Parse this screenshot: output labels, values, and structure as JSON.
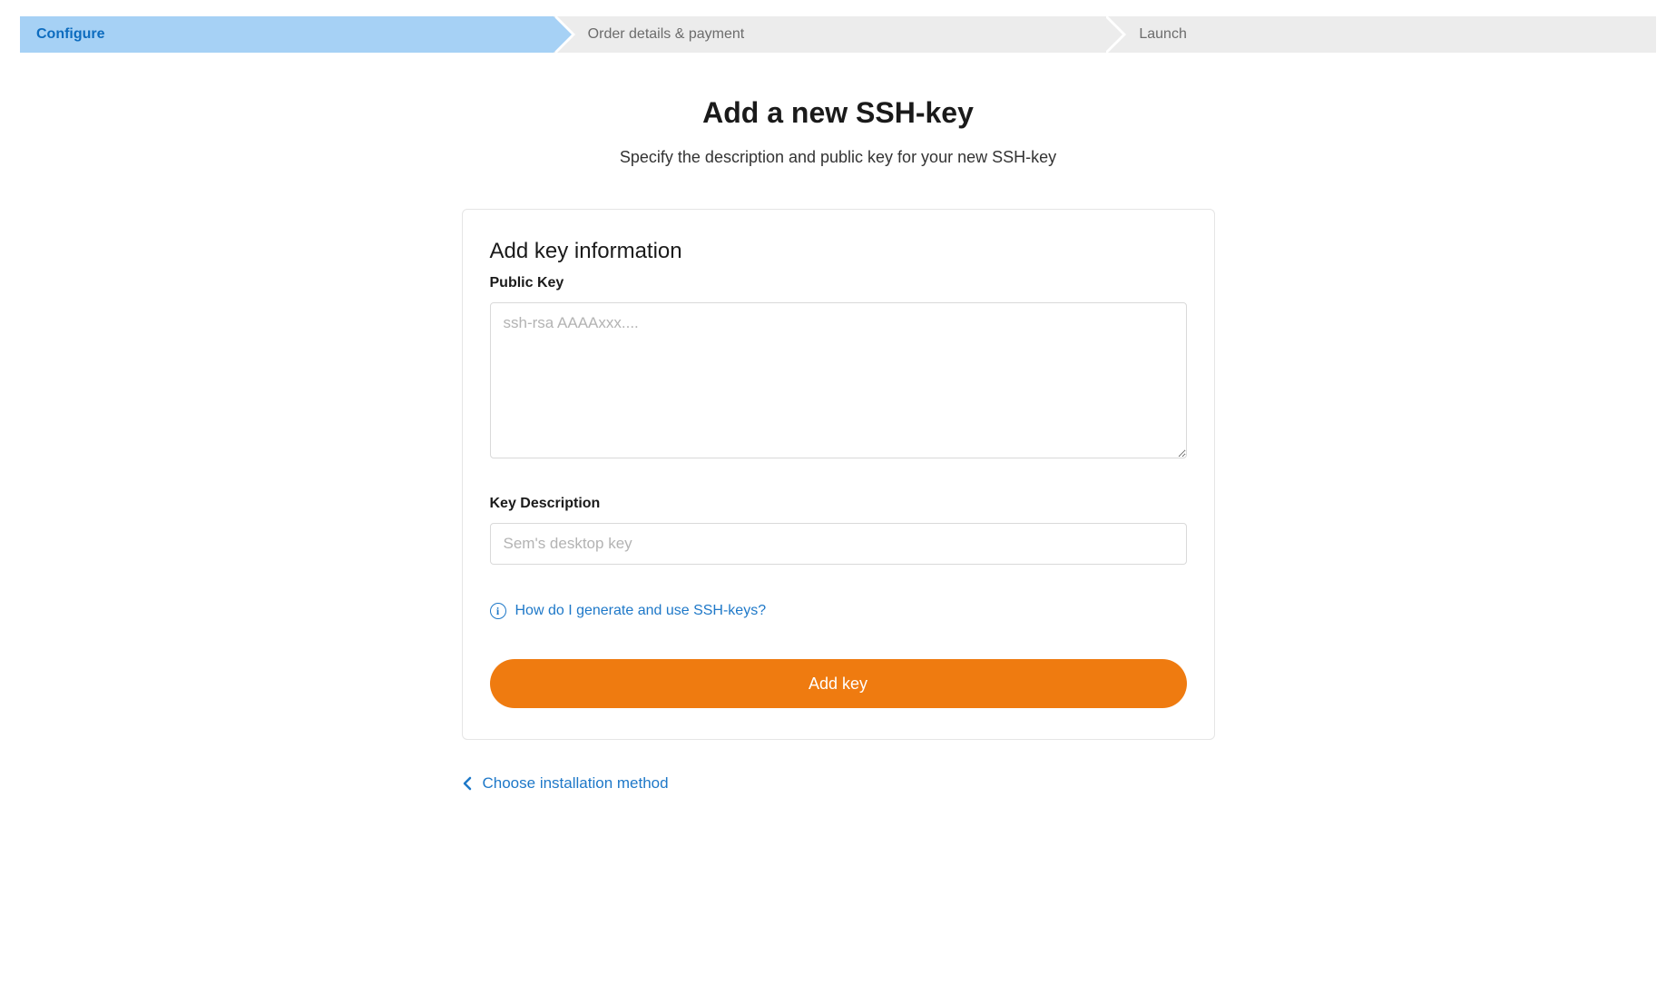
{
  "progress": {
    "steps": [
      {
        "label": "Configure",
        "active": true
      },
      {
        "label": "Order details & payment",
        "active": false
      },
      {
        "label": "Launch",
        "active": false
      }
    ]
  },
  "page": {
    "title": "Add a new SSH-key",
    "subtitle": "Specify the description and public key for your new SSH-key"
  },
  "form": {
    "section_title": "Add key information",
    "public_key": {
      "label": "Public Key",
      "placeholder": "ssh-rsa AAAAxxx....",
      "value": ""
    },
    "key_description": {
      "label": "Key Description",
      "placeholder": "Sem's desktop key",
      "value": ""
    },
    "help_link": "How do I generate and use SSH-keys?",
    "submit_label": "Add key"
  },
  "back_link": {
    "label": "Choose installation method"
  }
}
